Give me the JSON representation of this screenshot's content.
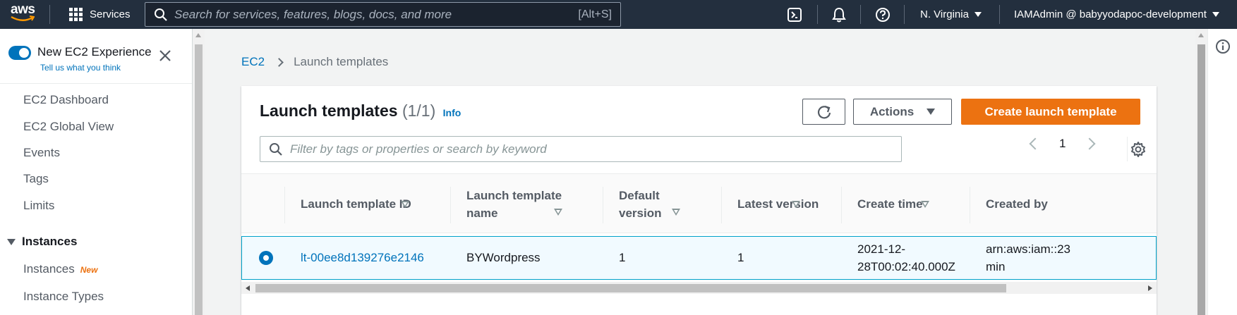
{
  "topnav": {
    "logo": "aws",
    "services_label": "Services",
    "search_placeholder": "Search for services, features, blogs, docs, and more",
    "search_shortcut": "[Alt+S]",
    "region": "N. Virginia",
    "account": "IAMAdmin @ babyyodapoc-development",
    "icons": [
      "cloudshell-icon",
      "bell-icon",
      "help-icon"
    ]
  },
  "sidebar": {
    "toggle_label": "New EC2 Experience",
    "feedback_link": "Tell us what you think",
    "items": [
      {
        "label": "EC2 Dashboard"
      },
      {
        "label": "EC2 Global View"
      },
      {
        "label": "Events"
      },
      {
        "label": "Tags"
      },
      {
        "label": "Limits"
      }
    ],
    "section": {
      "label": "Instances",
      "items": [
        {
          "label": "Instances",
          "badge": "New"
        },
        {
          "label": "Instance Types"
        }
      ]
    }
  },
  "breadcrumb": {
    "root": "EC2",
    "current": "Launch templates"
  },
  "panel": {
    "title": "Launch templates",
    "count": "(1/1)",
    "info": "Info",
    "actions_label": "Actions",
    "create_label": "Create launch template",
    "filter_placeholder": "Filter by tags or properties or search by keyword",
    "page": "1",
    "columns": [
      {
        "line1": "Launch template ID",
        "line2": ""
      },
      {
        "line1": "Launch template",
        "line2": "name"
      },
      {
        "line1": "Default",
        "line2": "version"
      },
      {
        "line1": "Latest version",
        "line2": ""
      },
      {
        "line1": "Create time",
        "line2": ""
      },
      {
        "line1": "Created by",
        "line2": ""
      }
    ],
    "rows": [
      {
        "selected": true,
        "id": "lt-00ee8d139276e2146",
        "name": "BYWordpress",
        "default_version": "1",
        "latest_version": "1",
        "create_time_1": "2021-12-",
        "create_time_2": "28T00:02:40.000Z",
        "created_by_1": "arn:aws:iam::23",
        "created_by_2": "min"
      }
    ]
  },
  "colors": {
    "nav_bg": "#232f3e",
    "link": "#0073bb",
    "primary": "#ec7211",
    "selected_row_bg": "#f1faff",
    "selected_row_border": "#00a1c9"
  }
}
